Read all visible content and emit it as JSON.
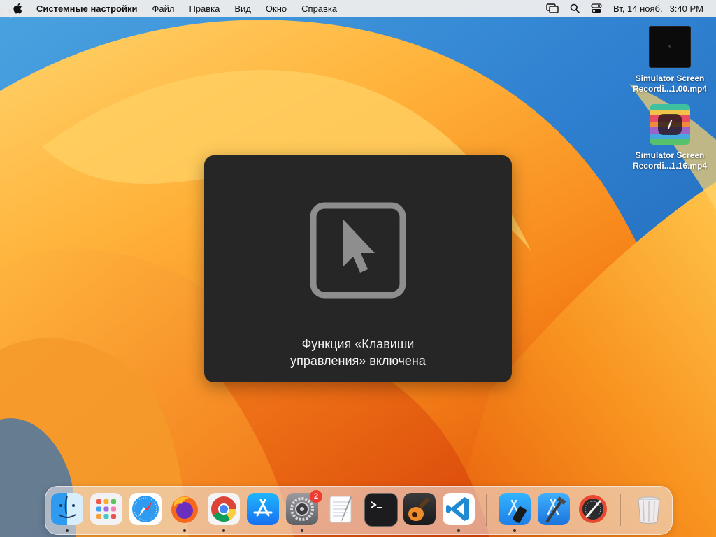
{
  "menubar": {
    "app_name": "Системные настройки",
    "items": [
      "Файл",
      "Правка",
      "Вид",
      "Окно",
      "Справка"
    ],
    "date": "Вт, 14 нояб.",
    "time": "3:40 PM"
  },
  "desktop": {
    "files": [
      {
        "line1": "Simulator Screen",
        "line2": "Recordi...1.00.mp4"
      },
      {
        "line1": "Simulator Screen",
        "line2": "Recordi...1.16.mp4"
      }
    ]
  },
  "hud": {
    "line1": "Функция «Клавиши",
    "line2": "управления» включена",
    "icon": "mouse-keys-pointer-icon"
  },
  "dock": {
    "apps": [
      {
        "name": "finder-icon",
        "running": true
      },
      {
        "name": "launchpad-icon",
        "running": false
      },
      {
        "name": "safari-icon",
        "running": false
      },
      {
        "name": "firefox-icon",
        "running": true
      },
      {
        "name": "chrome-icon",
        "running": true
      },
      {
        "name": "app-store-icon",
        "running": false
      },
      {
        "name": "system-settings-icon",
        "running": true,
        "badge": "2"
      },
      {
        "name": "textedit-icon",
        "running": false
      },
      {
        "name": "terminal-icon",
        "running": false
      },
      {
        "name": "garageband-icon",
        "running": false
      },
      {
        "name": "vscode-icon",
        "running": true
      },
      {
        "name": "simulator-icon",
        "running": true
      },
      {
        "name": "xcode-icon",
        "running": false
      },
      {
        "name": "instruments-icon",
        "running": false
      },
      {
        "name": "trash-icon",
        "running": false
      }
    ]
  },
  "colors": {
    "hud_background": "#262626",
    "badge": "#f23b30",
    "wallpaper_orange": "#f7941d"
  }
}
